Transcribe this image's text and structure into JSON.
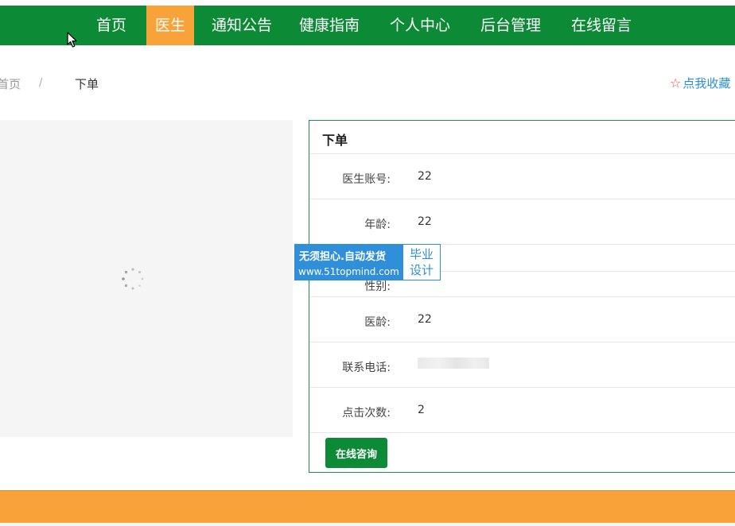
{
  "nav": {
    "items": [
      {
        "label": "首页",
        "active": false
      },
      {
        "label": "医生",
        "active": true
      },
      {
        "label": "通知公告",
        "active": false
      },
      {
        "label": "健康指南",
        "active": false
      },
      {
        "label": "个人中心",
        "active": false
      },
      {
        "label": "后台管理",
        "active": false
      },
      {
        "label": "在线留言",
        "active": false
      }
    ]
  },
  "breadcrumb": {
    "home": "首页",
    "separator": "/",
    "current": "下单"
  },
  "favorite": {
    "label": "点我收藏",
    "icon": "star-outline-icon"
  },
  "detail": {
    "title": "下单",
    "fields": [
      {
        "label": "医生账号:",
        "value": "22"
      },
      {
        "label": "年龄:",
        "value": "22"
      },
      {
        "label": "性别:",
        "value": ""
      },
      {
        "label": "医龄:",
        "value": "22"
      },
      {
        "label": "联系电话:",
        "value": ""
      },
      {
        "label": "点击次数:",
        "value": "2"
      }
    ],
    "consult_button": "在线咨询"
  },
  "watermark": {
    "line1": "无须担心.自动发货",
    "line2": "www.51topmind.com",
    "badge_line1": "毕业",
    "badge_line2": "设计"
  },
  "colors": {
    "nav_green": "#0c8a35",
    "accent_orange": "#f7a33a",
    "link_blue": "#2a8fd0"
  }
}
